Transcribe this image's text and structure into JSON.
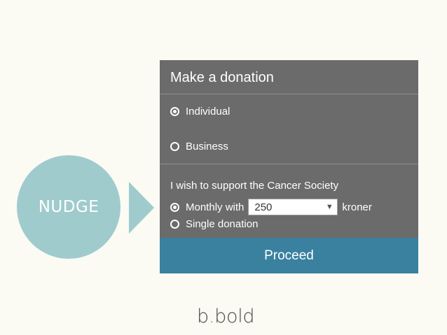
{
  "nudge": {
    "label": "NUDGE"
  },
  "donation_form": {
    "title": "Make a donation",
    "donor_type_options": [
      {
        "label": "Individual",
        "selected": true
      },
      {
        "label": "Business",
        "selected": false
      }
    ],
    "support_text": "I wish to support the Cancer Society",
    "frequency_options": [
      {
        "label": "Monthly with",
        "selected": true
      },
      {
        "label": "Single donation",
        "selected": false
      }
    ],
    "amount": {
      "value": "250",
      "unit": "kroner",
      "dropdown_icon": "triangle-down-icon"
    },
    "proceed_label": "Proceed"
  },
  "logo": {
    "part1": "b",
    "dot": ".",
    "part2": "bold",
    "dot_color": "#e0533f"
  },
  "colors": {
    "background": "#fbfaf3",
    "nudge": "#9fcbcd",
    "panel": "#6b6b6b",
    "proceed": "#3a81a0"
  }
}
